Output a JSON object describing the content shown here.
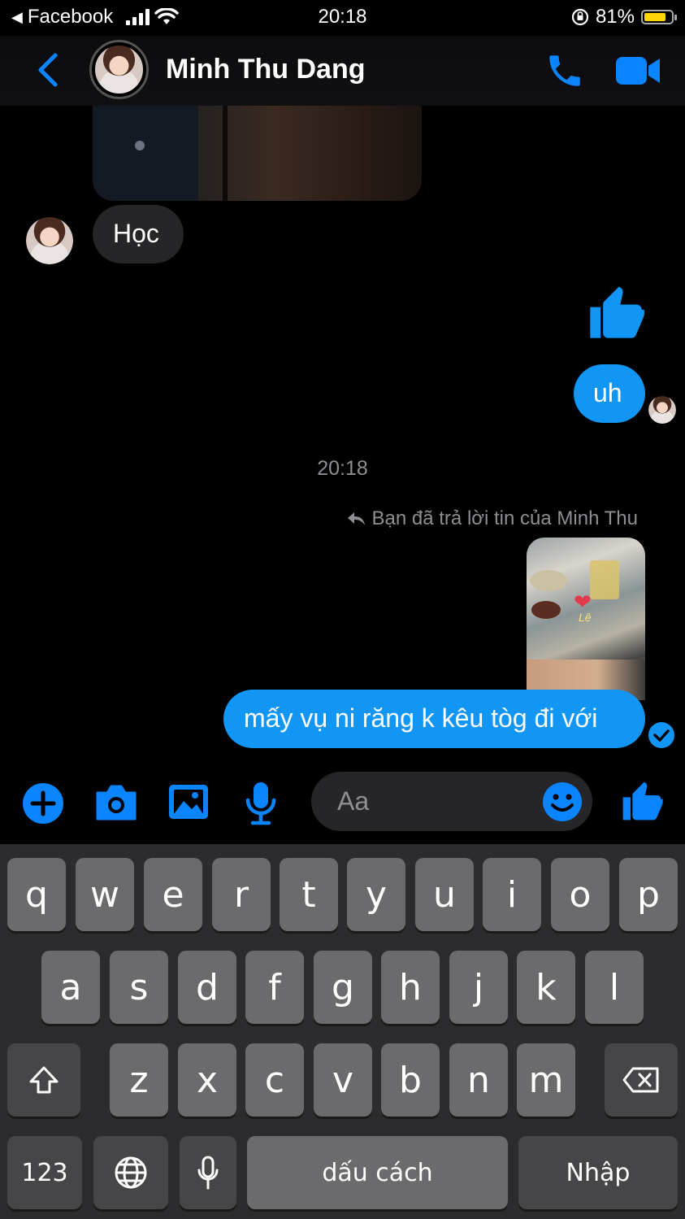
{
  "status_bar": {
    "back_app": "Facebook",
    "time": "20:18",
    "battery_percent": "81%",
    "battery_level": 0.81
  },
  "header": {
    "contact_name": "Minh Thu Dang"
  },
  "messages": {
    "incoming_text": "Học",
    "outgoing_text_1": "uh",
    "timestamp": "20:18",
    "reply_note": "Bạn đã trả lời tin của Minh Thu",
    "outgoing_text_2": "mấy vụ ni răng k kêu tòg đi với"
  },
  "composer": {
    "placeholder": "Aa"
  },
  "keyboard": {
    "row1": [
      "q",
      "w",
      "e",
      "r",
      "t",
      "y",
      "u",
      "i",
      "o",
      "p"
    ],
    "row2": [
      "a",
      "s",
      "d",
      "f",
      "g",
      "h",
      "j",
      "k",
      "l"
    ],
    "row3": [
      "z",
      "x",
      "c",
      "v",
      "b",
      "n",
      "m"
    ],
    "numbers_label": "123",
    "space_label": "dấu cách",
    "return_label": "Nhập"
  },
  "colors": {
    "accent": "#0a84ff",
    "bubble_out": "#1196f5",
    "bubble_in": "#262628"
  }
}
